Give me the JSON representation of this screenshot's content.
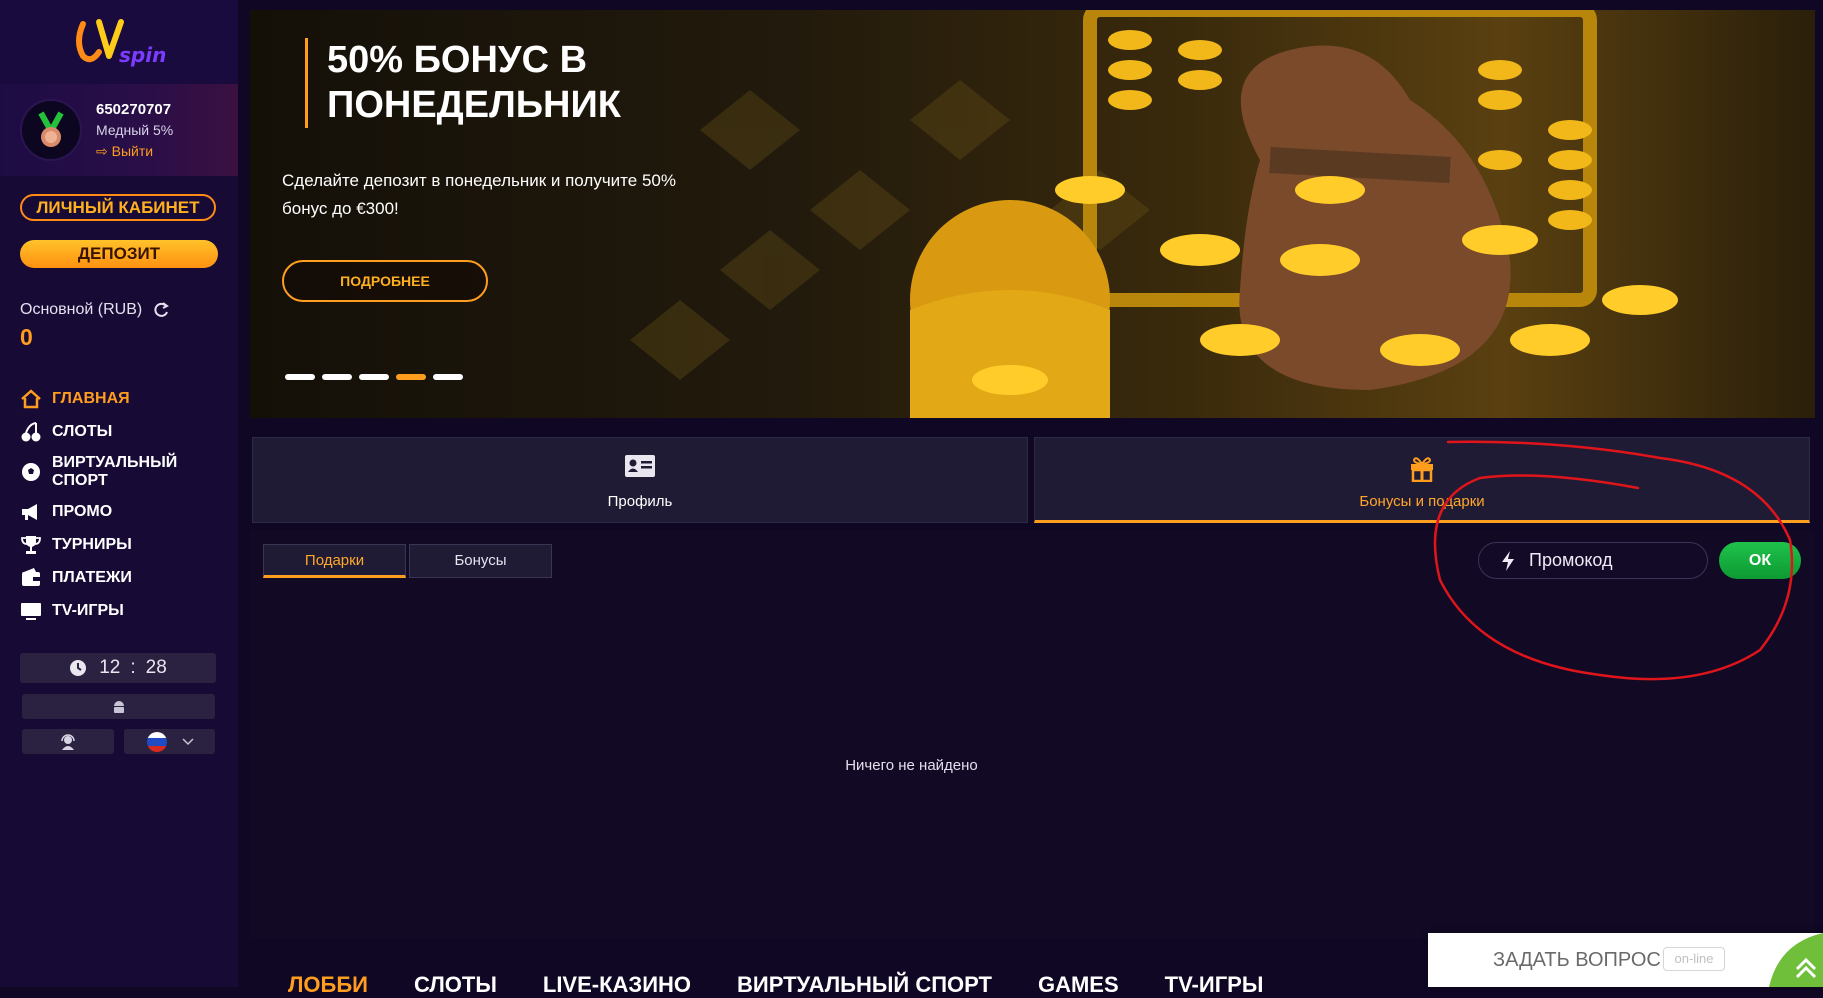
{
  "sidebar": {
    "logo_text": "spin",
    "user_id": "650270707",
    "user_level": "Медный 5%",
    "logout_label": "Выйти",
    "cabinet_button": "ЛИЧНЫЙ КАБИНЕТ",
    "deposit_button": "ДЕПОЗИТ",
    "balance_label": "Основной (RUB)",
    "balance_value": "0",
    "nav": [
      {
        "label": "ГЛАВНАЯ",
        "icon": "home-icon",
        "active": true
      },
      {
        "label": "СЛОТЫ",
        "icon": "cherries-icon"
      },
      {
        "label": "ВИРТУАЛЬНЫЙ СПОРТ",
        "icon": "soccer-ball-icon"
      },
      {
        "label": "ПРОМО",
        "icon": "megaphone-icon"
      },
      {
        "label": "ТУРНИРЫ",
        "icon": "trophy-icon"
      },
      {
        "label": "ПЛАТЕЖИ",
        "icon": "wallet-icon"
      },
      {
        "label": "TV-ИГРЫ",
        "icon": "tv-icon"
      }
    ],
    "clock": {
      "hours": "12",
      "sep": ":",
      "minutes": "28"
    },
    "language_flag": "ru"
  },
  "banner": {
    "title_line1": "50% БОНУС В",
    "title_line2": "ПОНЕДЕЛЬНИК",
    "text": "Сделайте депозит в понедельник и получите 50% бонус до €300!",
    "button": "ПОДРОБНЕЕ",
    "slides_total": 5,
    "active_slide": 4
  },
  "tabs": {
    "profile_label": "Профиль",
    "bonus_label": "Бонусы и подарки",
    "active": "bonus"
  },
  "subtabs": {
    "gifts_label": "Подарки",
    "bonuses_label": "Бонусы",
    "active": "gifts"
  },
  "promo": {
    "placeholder": "Промокод",
    "ok_label": "ОК"
  },
  "empty_message": "Ничего не найдено",
  "bottom_nav": [
    "ЛОББИ",
    "СЛОТЫ",
    "LIVE-КАЗИНО",
    "ВИРТУАЛЬНЫЙ СПОРТ",
    "GAMES",
    "TV-ИГРЫ"
  ],
  "chat": {
    "label": "ЗАДАТЬ ВОПРОС",
    "status": "on-line"
  },
  "colors": {
    "accent": "#ff9d1f",
    "sidebar_bg": "#170a35",
    "page_bg": "#0f0723",
    "ok_green": "#14b03e",
    "annotation_red": "#e0151b"
  }
}
